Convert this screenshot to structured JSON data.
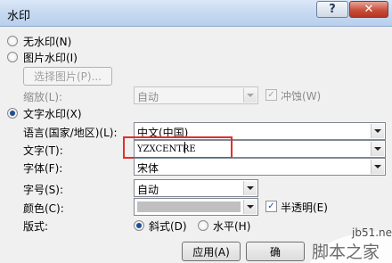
{
  "window": {
    "title": "水印",
    "help_label": "?",
    "close_label": "✕"
  },
  "options": {
    "no_watermark": "无水印(N)",
    "picture_watermark": "图片水印(I)",
    "select_picture": "选择图片(P)...",
    "scale_label": "缩放(L):",
    "scale_value": "自动",
    "washout_label": "冲蚀(W)",
    "text_watermark": "文字水印(X)"
  },
  "fields": {
    "language_label": "语言(国家/地区)(L):",
    "language_value": "中文(中国)",
    "text_label": "文字(T):",
    "text_value": "YZXCENTRE",
    "font_label": "字体(F):",
    "font_value": "宋体",
    "size_label": "字号(S):",
    "size_value": "自动",
    "color_label": "颜色(C):",
    "semitransparent_label": "半透明(E)",
    "layout_label": "版式:",
    "diagonal_label": "斜式(D)",
    "horizontal_label": "水平(H)"
  },
  "buttons": {
    "apply": "应用(A)",
    "ok_partial": "确"
  },
  "overlay": {
    "site_url": "jb51.net",
    "site_brand": "脚本之家"
  },
  "colors": {
    "highlight_border": "#e0302b"
  }
}
